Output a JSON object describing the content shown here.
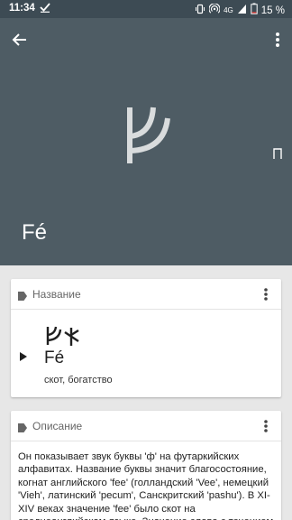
{
  "status_bar": {
    "time": "11:34",
    "battery": "15 %",
    "network": "4G",
    "icons": [
      "checkmark-icon",
      "vibrate-icon",
      "hotspot-icon",
      "signal-icon",
      "battery-icon"
    ]
  },
  "hero": {
    "title": "Fé",
    "icons": [
      "back-arrow-icon",
      "more-vert-icon"
    ],
    "background_color": "#4e5c64"
  },
  "name_card": {
    "header": "Название",
    "latin": "Fé",
    "meaning": "скот, богатство",
    "icons": [
      "label-icon",
      "more-vert-icon",
      "play-icon"
    ]
  },
  "description_card": {
    "header": "Описание",
    "text": "Он показывает звук буквы 'ф' на футаркийских алфавитах. Название буквы значит благосостояние, когнат английского 'fee' (голландский 'Vee', немецкий 'Vieh', латинский 'pecum', Санскритский 'pashu'). В XI-XIV веках значение 'fee' было скот на среднеанглийском языке. Значение слова с течением",
    "icons": [
      "label-icon",
      "more-vert-icon"
    ]
  }
}
